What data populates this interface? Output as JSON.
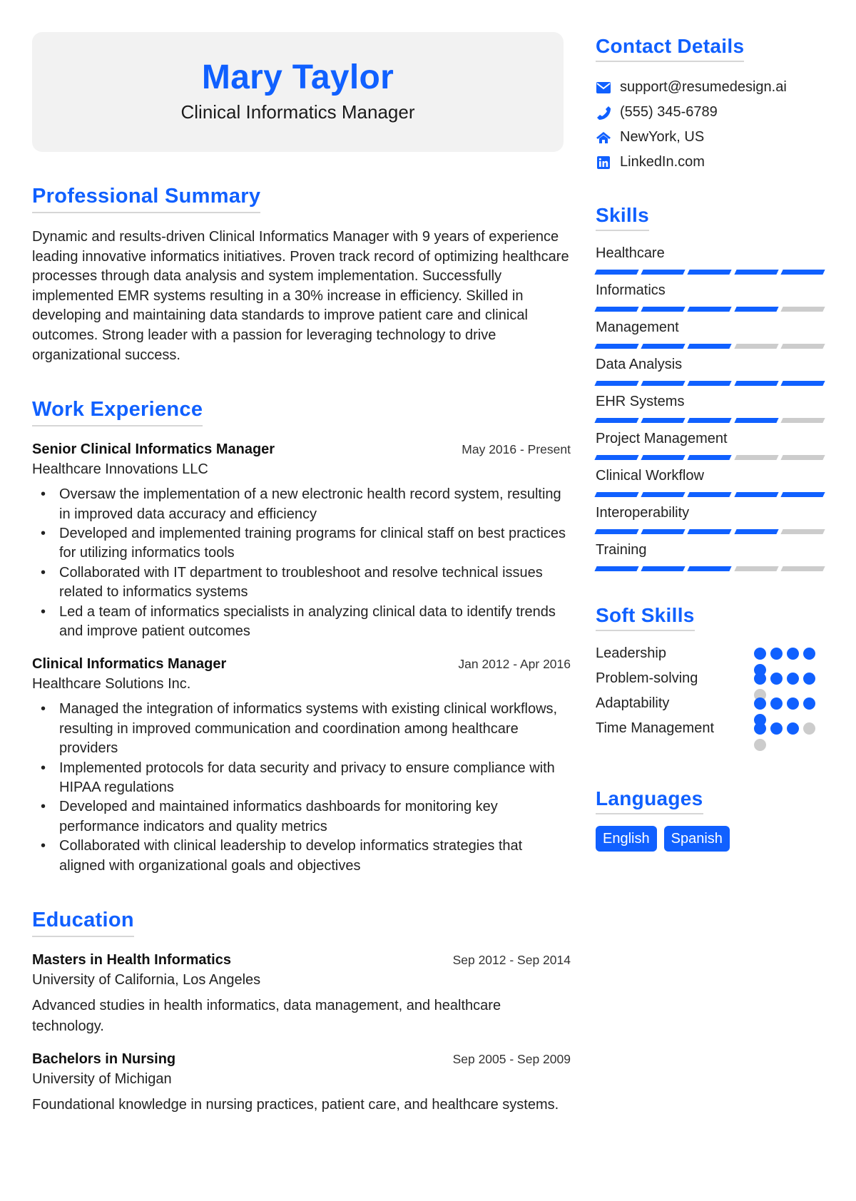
{
  "header": {
    "name": "Mary Taylor",
    "title": "Clinical Informatics Manager"
  },
  "summary": {
    "heading": "Professional Summary",
    "text": "Dynamic and results-driven Clinical Informatics Manager with 9 years of experience leading innovative informatics initiatives. Proven track record of optimizing healthcare processes through data analysis and system implementation. Successfully implemented EMR systems resulting in a 30% increase in efficiency. Skilled in developing and maintaining data standards to improve patient care and clinical outcomes. Strong leader with a passion for leveraging technology to drive organizational success."
  },
  "experience": {
    "heading": "Work Experience",
    "jobs": [
      {
        "title": "Senior Clinical Informatics Manager",
        "date": "May 2016 - Present",
        "company": "Healthcare Innovations LLC",
        "bullets": [
          "Oversaw the implementation of a new electronic health record system, resulting in improved data accuracy and efficiency",
          "Developed and implemented training programs for clinical staff on best practices for utilizing informatics tools",
          "Collaborated with IT department to troubleshoot and resolve technical issues related to informatics systems",
          "Led a team of informatics specialists in analyzing clinical data to identify trends and improve patient outcomes"
        ]
      },
      {
        "title": "Clinical Informatics Manager",
        "date": "Jan 2012 - Apr 2016",
        "company": "Healthcare Solutions Inc.",
        "bullets": [
          "Managed the integration of informatics systems with existing clinical workflows, resulting in improved communication and coordination among healthcare providers",
          "Implemented protocols for data security and privacy to ensure compliance with HIPAA regulations",
          "Developed and maintained informatics dashboards for monitoring key performance indicators and quality metrics",
          "Collaborated with clinical leadership to develop informatics strategies that aligned with organizational goals and objectives"
        ]
      }
    ]
  },
  "education": {
    "heading": "Education",
    "items": [
      {
        "degree": "Masters in Health Informatics",
        "date": "Sep 2012 - Sep 2014",
        "school": "University of California, Los Angeles",
        "description": "Advanced studies in health informatics, data management, and healthcare technology."
      },
      {
        "degree": "Bachelors in Nursing",
        "date": "Sep 2005 - Sep 2009",
        "school": "University of Michigan",
        "description": "Foundational knowledge in nursing practices, patient care, and healthcare systems."
      }
    ]
  },
  "contact": {
    "heading": "Contact Details",
    "items": [
      {
        "icon": "envelope-icon",
        "value": "support@resumedesign.ai"
      },
      {
        "icon": "phone-icon",
        "value": "(555) 345-6789"
      },
      {
        "icon": "home-icon",
        "value": "NewYork, US"
      },
      {
        "icon": "linkedin-icon",
        "value": "LinkedIn.com"
      }
    ]
  },
  "skills": {
    "heading": "Skills",
    "max": 5,
    "items": [
      {
        "name": "Healthcare",
        "level": 5
      },
      {
        "name": "Informatics",
        "level": 4
      },
      {
        "name": "Management",
        "level": 3
      },
      {
        "name": "Data Analysis",
        "level": 5
      },
      {
        "name": "EHR Systems",
        "level": 4
      },
      {
        "name": "Project Management",
        "level": 3
      },
      {
        "name": "Clinical Workflow",
        "level": 5
      },
      {
        "name": "Interoperability",
        "level": 4
      },
      {
        "name": "Training",
        "level": 3
      }
    ]
  },
  "soft_skills": {
    "heading": "Soft Skills",
    "max": 5,
    "items": [
      {
        "name": "Leadership",
        "level": 5
      },
      {
        "name": "Problem-solving",
        "level": 4
      },
      {
        "name": "Adaptability",
        "level": 5
      },
      {
        "name": "Time Management",
        "level": 3
      }
    ]
  },
  "languages": {
    "heading": "Languages",
    "items": [
      "English",
      "Spanish"
    ]
  },
  "colors": {
    "accent": "#1060ff",
    "header_bg": "#f2f2f2",
    "inactive": "#cccccc"
  }
}
